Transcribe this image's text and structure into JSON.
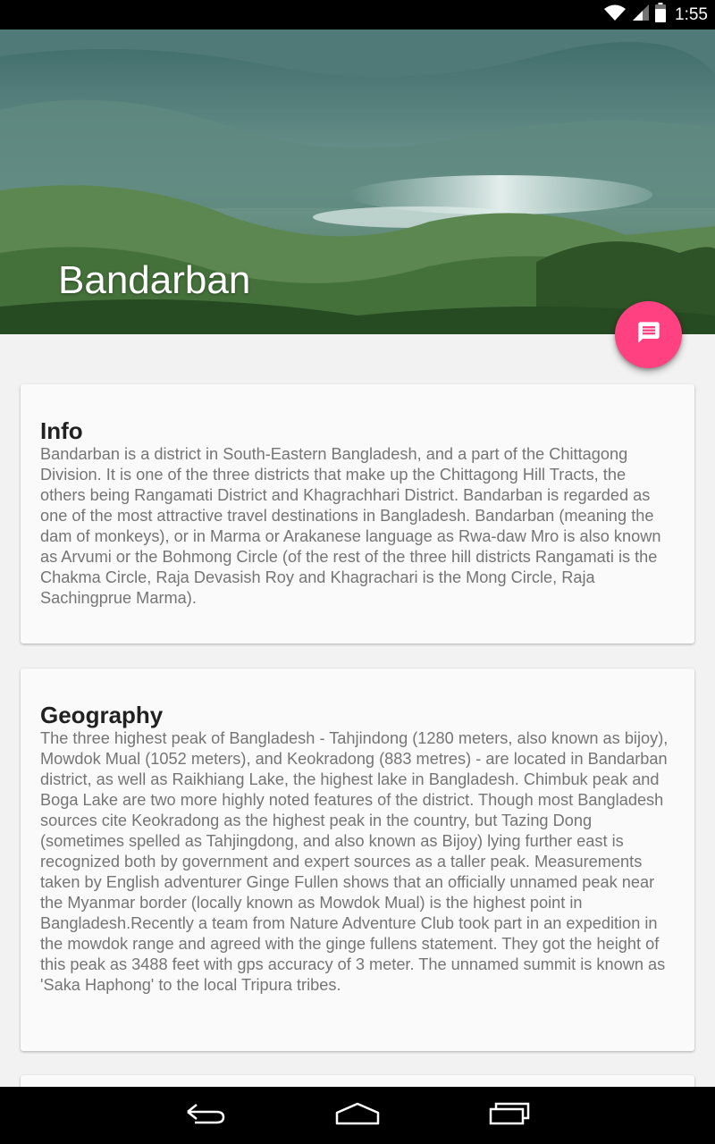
{
  "status_bar": {
    "time": "1:55",
    "icons": [
      "wifi-icon",
      "signal-icon",
      "battery-icon"
    ]
  },
  "hero": {
    "title": "Bandarban"
  },
  "fab": {
    "icon": "message-icon",
    "color": "#ff4081"
  },
  "cards": [
    {
      "title": "Info",
      "body": "Bandarban is a district in South-Eastern Bangladesh, and a part of the Chittagong Division. It is one of the three districts that make up the Chittagong Hill Tracts, the others being Rangamati District and Khagrachhari District. Bandarban is regarded as one of the most attractive travel destinations in Bangladesh. Bandarban (meaning the dam of monkeys), or in Marma or Arakanese language as Rwa-daw Mro is also known as Arvumi or the Bohmong Circle (of the rest of the three hill districts Rangamati is the Chakma Circle, Raja Devasish Roy and Khagrachari is the Mong Circle, Raja Sachingprue Marma)."
    },
    {
      "title": "Geography",
      "body": "The three highest peak of Bangladesh - Tahjindong (1280 meters, also known as bijoy), Mowdok Mual (1052 meters), and Keokradong (883 metres) - are located in Bandarban district, as well as Raikhiang Lake, the highest lake in Bangladesh. Chimbuk peak and Boga Lake are two more highly noted features of the district. Though most Bangladesh sources cite Keokradong as the highest peak in the country, but Tazing Dong (sometimes spelled as Tahjingdong, and also known as Bijoy) lying further east is recognized both by government and expert sources as a taller peak. Measurements taken by English adventurer Ginge Fullen shows that an officially unnamed peak near the Myanmar border (locally known as Mowdok Mual) is the highest point in Bangladesh.Recently a team from Nature Adventure Club took part in an expedition in the mowdok range and agreed with the ginge fullens statement. They got the height of this peak as 3488 feet with gps accuracy of 3 meter. The unnamed summit is known as 'Saka Haphong' to the local Tripura tribes."
    }
  ],
  "nav_bar": {
    "buttons": [
      "back-icon",
      "home-icon",
      "recents-icon"
    ]
  }
}
